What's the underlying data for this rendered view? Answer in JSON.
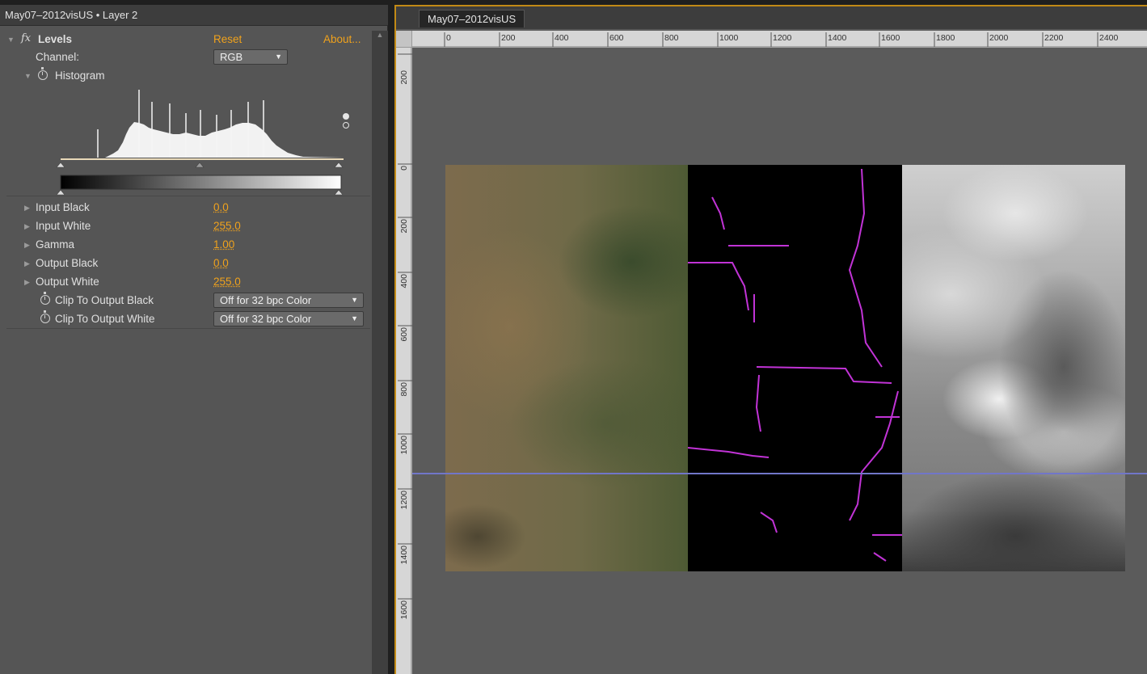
{
  "effect_controls": {
    "title": "May07–2012visUS • Layer 2",
    "effect": {
      "fx_label": "fx",
      "name": "Levels",
      "reset_label": "Reset",
      "about_label": "About...",
      "channel_label": "Channel:",
      "channel_value": "RGB",
      "histogram_label": "Histogram"
    },
    "properties": [
      {
        "label": "Input Black",
        "value": "0.0"
      },
      {
        "label": "Input White",
        "value": "255.0"
      },
      {
        "label": "Gamma",
        "value": "1.00"
      },
      {
        "label": "Output Black",
        "value": "0.0"
      },
      {
        "label": "Output White",
        "value": "255.0"
      }
    ],
    "clip_options": [
      {
        "label": "Clip To Output Black",
        "value": "Off for 32 bpc Color"
      },
      {
        "label": "Clip To Output White",
        "value": "Off for 32 bpc Color"
      }
    ],
    "icons": {
      "expand": "triangle-icon",
      "stopwatch": "stopwatch-icon",
      "dropdown": "chevron-down-icon"
    }
  },
  "composition": {
    "tab_label": "May07–2012visUS",
    "ruler_top_labels": [
      "0",
      "200",
      "400",
      "600",
      "800",
      "1000",
      "1200",
      "1400",
      "1600",
      "1800",
      "2000",
      "2200",
      "2400"
    ],
    "ruler_left_labels": [
      "200",
      "0",
      "200",
      "400",
      "600",
      "800",
      "1000",
      "1200",
      "1400",
      "1600"
    ]
  },
  "colors": {
    "accent": "#f0a21c",
    "panel_bg": "#555555",
    "guide": "#7176c9",
    "boundary_lines": "#c133d6"
  }
}
